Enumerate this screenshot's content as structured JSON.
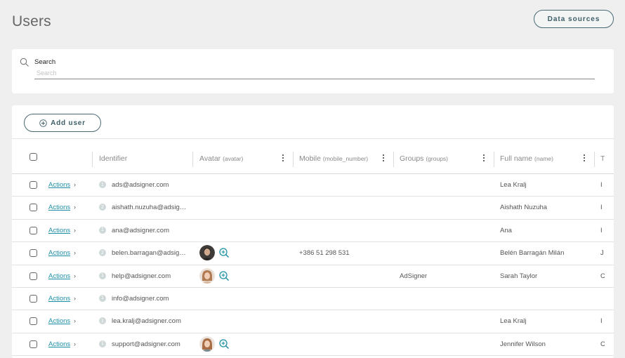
{
  "page": {
    "title": "Users"
  },
  "header": {
    "data_sources_label": "Data sources"
  },
  "search": {
    "label": "Search",
    "placeholder": "Search",
    "value": ""
  },
  "toolbar": {
    "add_user_label": "Add user"
  },
  "columns": {
    "identifier": {
      "title": "Identifier"
    },
    "avatar": {
      "title": "Avatar",
      "sub": "(avatar)"
    },
    "mobile": {
      "title": "Mobile",
      "sub": "(mobile_number)"
    },
    "groups": {
      "title": "Groups",
      "sub": "(groups)"
    },
    "fullname": {
      "title": "Full name",
      "sub": "(name)"
    },
    "next_clip": "T"
  },
  "rows": [
    {
      "actions": "Actions",
      "badge": "1",
      "identifier": "ads@adsigner.com",
      "avatar": "",
      "mobile": "",
      "groups": "",
      "fullname": "Lea Kralj",
      "next_clip": "I"
    },
    {
      "actions": "Actions",
      "badge": "2",
      "identifier": "aishath.nuzuha@adsign...",
      "avatar": "",
      "mobile": "",
      "groups": "",
      "fullname": "Aishath Nuzuha",
      "next_clip": "I"
    },
    {
      "actions": "Actions",
      "badge": "1",
      "identifier": "ana@adsigner.com",
      "avatar": "",
      "mobile": "",
      "groups": "",
      "fullname": "Ana",
      "next_clip": "I"
    },
    {
      "actions": "Actions",
      "badge": "2",
      "identifier": "belen.barragan@adsign...",
      "avatar": "dark",
      "mobile": "+386 51 298 531",
      "groups": "",
      "fullname": "Belén Barragán Milán",
      "next_clip": "J"
    },
    {
      "actions": "Actions",
      "badge": "1",
      "identifier": "help@adsigner.com",
      "avatar": "light",
      "mobile": "",
      "groups": "AdSigner",
      "fullname": "Sarah Taylor",
      "next_clip": "C"
    },
    {
      "actions": "Actions",
      "badge": "1",
      "identifier": "info@adsigner.com",
      "avatar": "",
      "mobile": "",
      "groups": "",
      "fullname": "",
      "next_clip": ""
    },
    {
      "actions": "Actions",
      "badge": "1",
      "identifier": "lea.kralj@adsigner.com",
      "avatar": "",
      "mobile": "",
      "groups": "",
      "fullname": "Lea Kralj",
      "next_clip": "I"
    },
    {
      "actions": "Actions",
      "badge": "1",
      "identifier": "support@adsigner.com",
      "avatar": "light",
      "mobile": "",
      "groups": "",
      "fullname": "Jennifer Wilson",
      "next_clip": "C"
    }
  ],
  "colors": {
    "accent": "#1f8fa6",
    "button_border": "#4a6a73",
    "background": "#efefef"
  },
  "icons": {
    "search": "search-icon",
    "add": "plus-circle-icon",
    "kebab": "more-vertical-icon",
    "zoom": "zoom-in-icon",
    "chevron": "chevron-right-icon"
  }
}
